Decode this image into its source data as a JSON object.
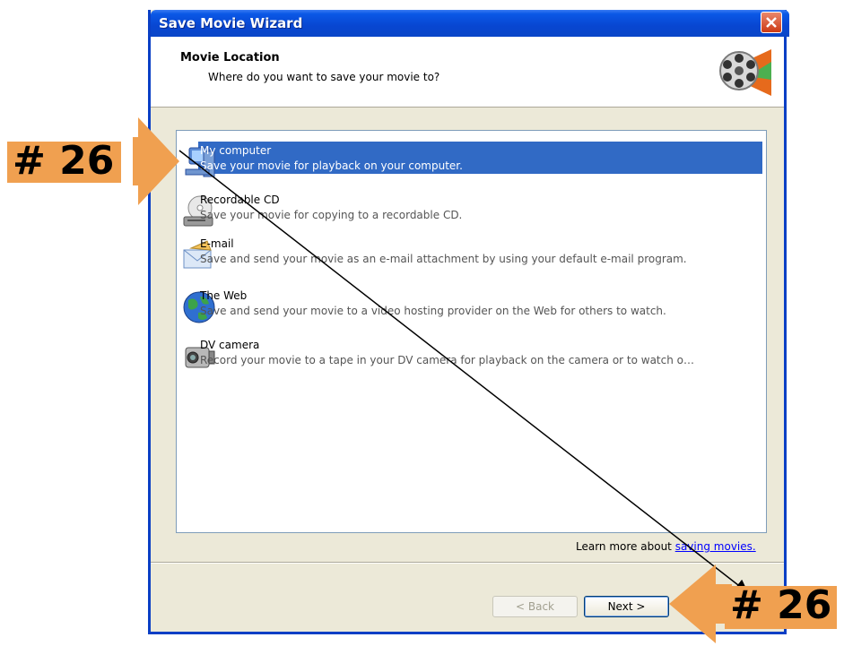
{
  "window": {
    "title": "Save Movie Wizard"
  },
  "header": {
    "title": "Movie Location",
    "subtitle": "Where do you want to save your movie to?"
  },
  "options": [
    {
      "label": "My computer",
      "description": "Save your movie for playback on your computer.",
      "icon": "my-computer-icon",
      "selected": true
    },
    {
      "label": "Recordable CD",
      "description": "Save your movie for copying to a recordable CD.",
      "icon": "cd-drive-icon",
      "selected": false
    },
    {
      "label": "E-mail",
      "description": "Save and send your movie as an e-mail attachment by using your default e-mail program.",
      "icon": "email-icon",
      "selected": false
    },
    {
      "label": "The Web",
      "description": "Save and send your movie to a video hosting provider on the Web for others to watch.",
      "icon": "globe-icon",
      "selected": false
    },
    {
      "label": "DV camera",
      "description": "Record your movie to a tape in your DV camera for playback on the camera or to watch o…",
      "icon": "camcorder-icon",
      "selected": false
    }
  ],
  "learn_more": {
    "prefix": "Learn more about ",
    "link": "saving movies."
  },
  "buttons": {
    "back": "< Back",
    "next": "Next >"
  },
  "annotations": {
    "left": "# 26",
    "right": "# 26",
    "color": "#f0a050"
  }
}
